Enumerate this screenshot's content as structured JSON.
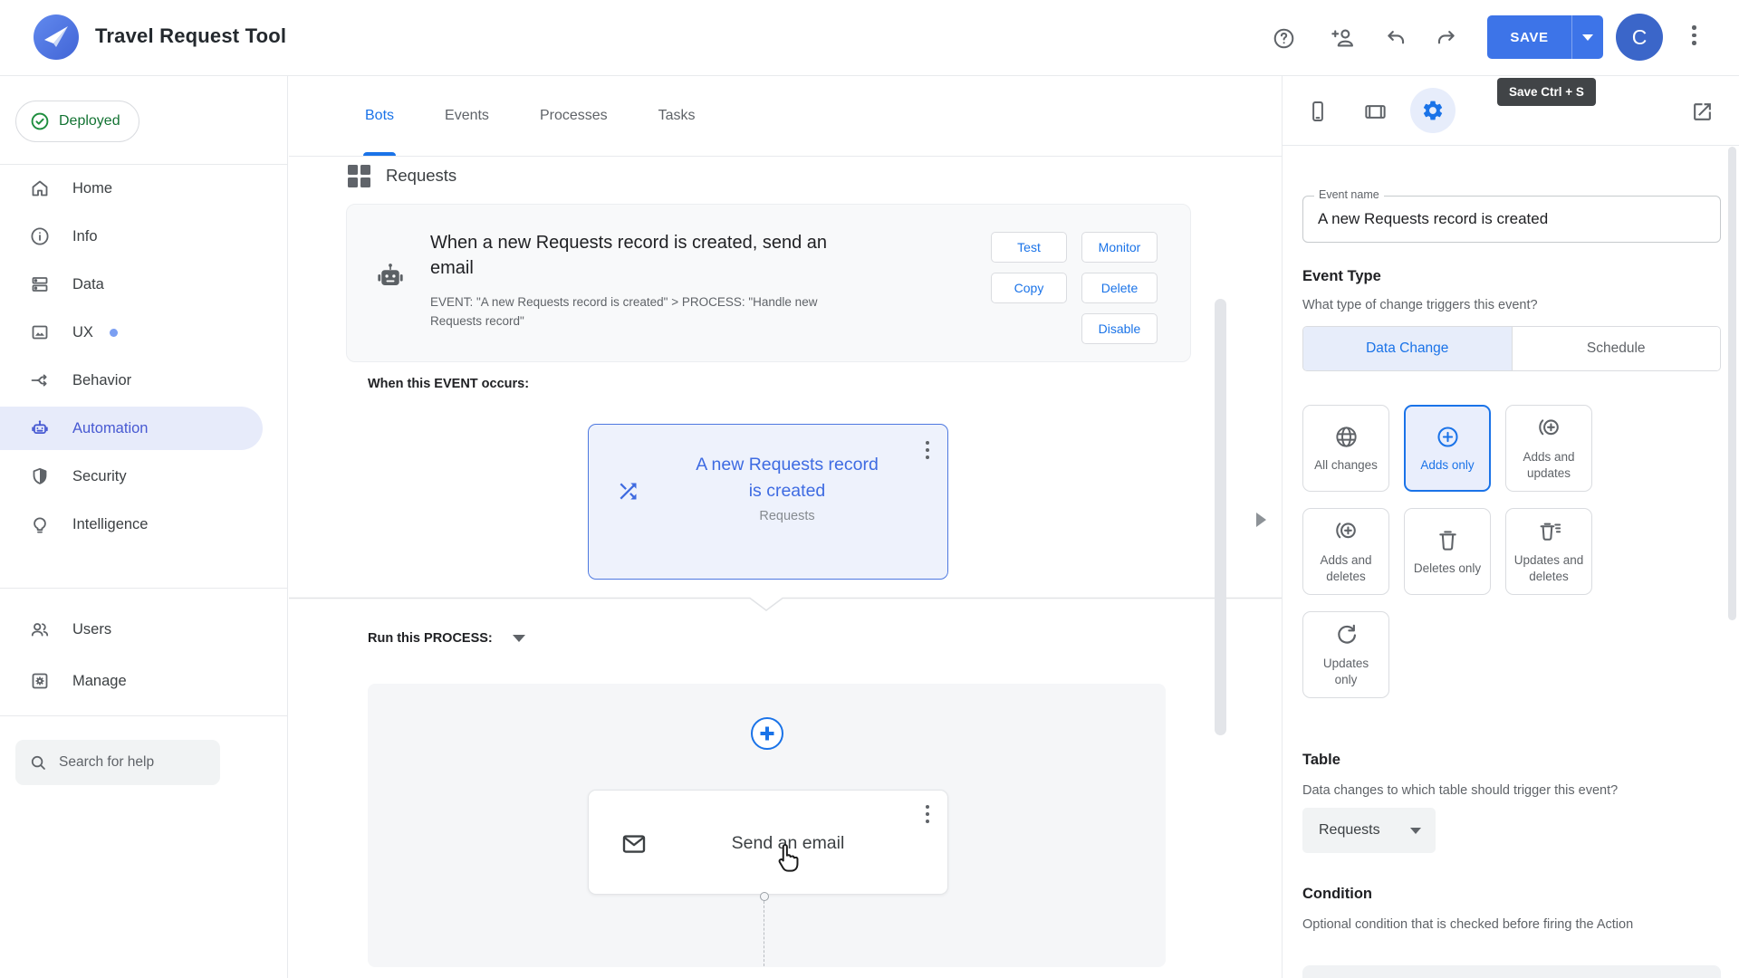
{
  "colors": {
    "accent": "#1a73e8",
    "selected_tint": "#e8eefb",
    "indigo": "#4759d2",
    "green": "#137333"
  },
  "header": {
    "app_title": "Travel Request Tool",
    "save_button": "SAVE",
    "avatar_initial": "C",
    "save_tooltip": "Save Ctrl + S"
  },
  "sidebar": {
    "deployed_badge": "Deployed",
    "items": [
      {
        "label": "Home"
      },
      {
        "label": "Info"
      },
      {
        "label": "Data"
      },
      {
        "label": "UX"
      },
      {
        "label": "Behavior"
      },
      {
        "label": "Automation"
      },
      {
        "label": "Security"
      },
      {
        "label": "Intelligence"
      },
      {
        "label": "Users"
      },
      {
        "label": "Manage"
      }
    ],
    "search_placeholder": "Search for help"
  },
  "main": {
    "tabs": [
      {
        "label": "Bots"
      },
      {
        "label": "Events"
      },
      {
        "label": "Processes"
      },
      {
        "label": "Tasks"
      }
    ],
    "breadcrumb": "Requests",
    "bot_card": {
      "title": "When a new Requests record is created, send an email",
      "subtitle": "EVENT: \"A new Requests record is created\" > PROCESS: \"Handle new Requests record\"",
      "actions": [
        {
          "label": "Test"
        },
        {
          "label": "Monitor"
        },
        {
          "label": "Copy"
        },
        {
          "label": "Delete"
        },
        {
          "label": "Disable"
        }
      ]
    },
    "event_section": {
      "heading": "When this EVENT occurs:",
      "card_title": "A new Requests record is created",
      "card_table": "Requests"
    },
    "process_section": {
      "heading": "Run this PROCESS:",
      "step_title": "Send an email"
    }
  },
  "right_panel": {
    "event_name_label": "Event name",
    "event_name_value": "A new Requests record is created",
    "event_type_heading": "Event Type",
    "event_type_question": "What type of change triggers this event?",
    "toggle": [
      {
        "label": "Data Change"
      },
      {
        "label": "Schedule"
      }
    ],
    "change_options": [
      {
        "label": "All changes"
      },
      {
        "label": "Adds only"
      },
      {
        "label": "Adds and updates"
      },
      {
        "label": "Adds and deletes"
      },
      {
        "label": "Deletes only"
      },
      {
        "label": "Updates and deletes"
      },
      {
        "label": "Updates only"
      }
    ],
    "table_heading": "Table",
    "table_question": "Data changes to which table should trigger this event?",
    "table_value": "Requests",
    "condition_heading": "Condition",
    "condition_description": "Optional condition that is checked before firing the Action"
  }
}
